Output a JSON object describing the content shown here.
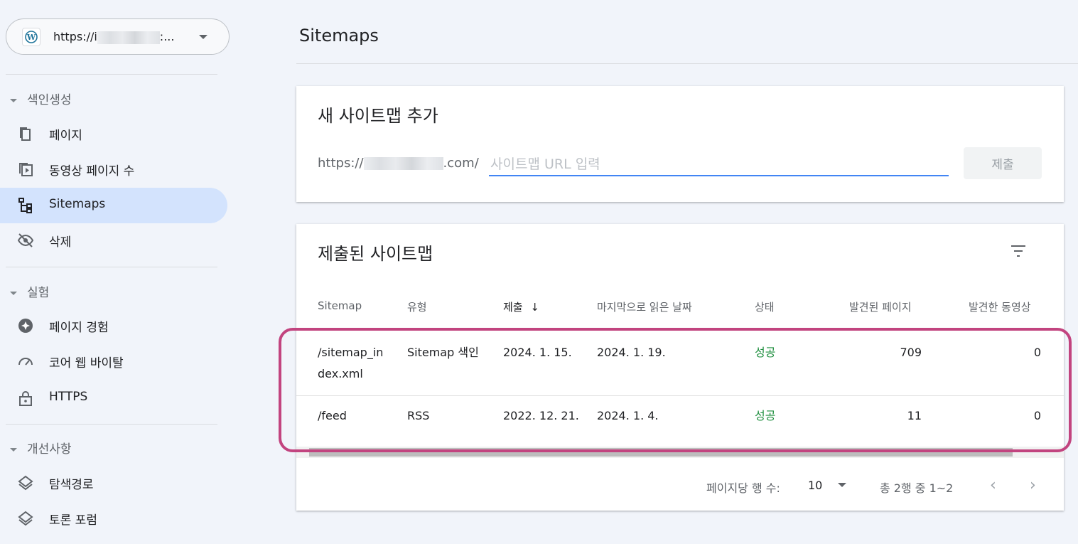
{
  "property": {
    "url_prefix": "https://i",
    "url_suffix": ":..."
  },
  "nav": {
    "section_indexing": "색인생성",
    "pages": "페이지",
    "video_pages": "동영상 페이지 수",
    "sitemaps": "Sitemaps",
    "removals": "삭제",
    "section_experience": "실험",
    "page_experience": "페이지 경험",
    "core_web_vitals": "코어 웹 바이탈",
    "https": "HTTPS",
    "section_enhancements": "개선사항",
    "breadcrumbs": "탐색경로",
    "discussion_forum": "토론 포럼"
  },
  "page_title": "Sitemaps",
  "add_sitemap": {
    "title": "새 사이트맵 추가",
    "prefix_start": "https://",
    "prefix_end": ".com/",
    "placeholder": "사이트맵 URL 입력",
    "submit_label": "제출"
  },
  "submitted": {
    "title": "제출된 사이트맵",
    "columns": [
      "Sitemap",
      "유형",
      "제출",
      "마지막으로 읽은 날짜",
      "상태",
      "발견된 페이지",
      "발견한 동영상"
    ],
    "sort_arrow": "↓",
    "rows": [
      {
        "sitemap": "/sitemap_index.xml",
        "sitemap_line1": "/sitemap_in",
        "sitemap_line2": "dex.xml",
        "type": "Sitemap 색인",
        "submitted": "2024. 1. 15.",
        "last_read": "2024. 1. 19.",
        "status": "성공",
        "pages": "709",
        "videos": "0"
      },
      {
        "sitemap": "/feed",
        "sitemap_line1": "/feed",
        "sitemap_line2": "",
        "type": "RSS",
        "submitted": "2022. 12. 21.",
        "last_read": "2024. 1. 4.",
        "status": "성공",
        "pages": "11",
        "videos": "0"
      }
    ]
  },
  "pagination": {
    "rows_per_page_label": "페이지당 행 수:",
    "rows_per_page": "10",
    "range": "총 2행 중 1~2",
    "prev": "‹",
    "next": "›"
  },
  "colors": {
    "accent_blue": "#4285f4",
    "success_green": "#1e8e3e",
    "highlight": "#c2447f",
    "active_nav": "#d3e3fd"
  }
}
